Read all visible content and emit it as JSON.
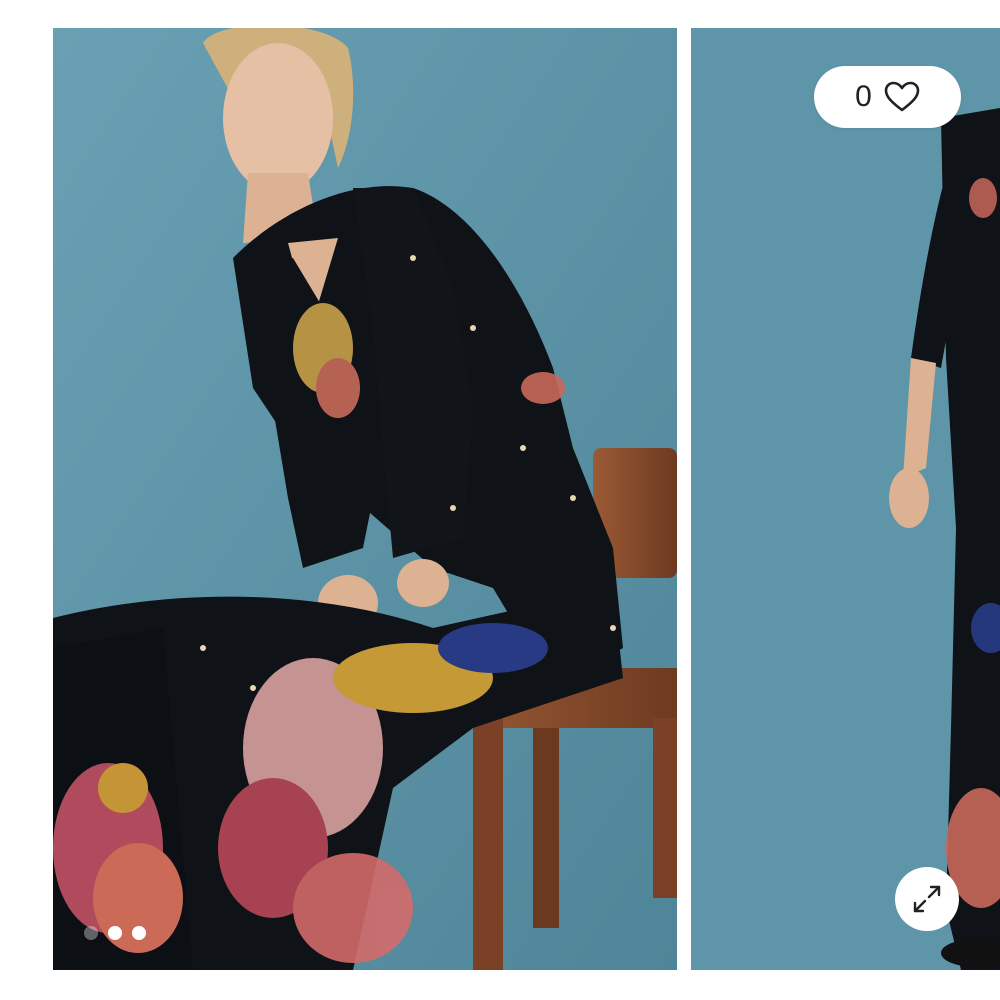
{
  "gallery": {
    "slides": [
      {
        "description_icon": "product-photo-seated-model"
      },
      {
        "description_icon": "product-photo-standing-model"
      }
    ],
    "active_slide": 1,
    "slide_count": 3
  },
  "like": {
    "count": "0",
    "icon": "heart-outline-icon"
  },
  "expand": {
    "icon": "expand-arrows-icon"
  },
  "colors": {
    "backdrop": "#5f95a8",
    "garment": "#0f1216",
    "chair": "#8a4b2c",
    "overlay_bg": "#ffffff"
  }
}
